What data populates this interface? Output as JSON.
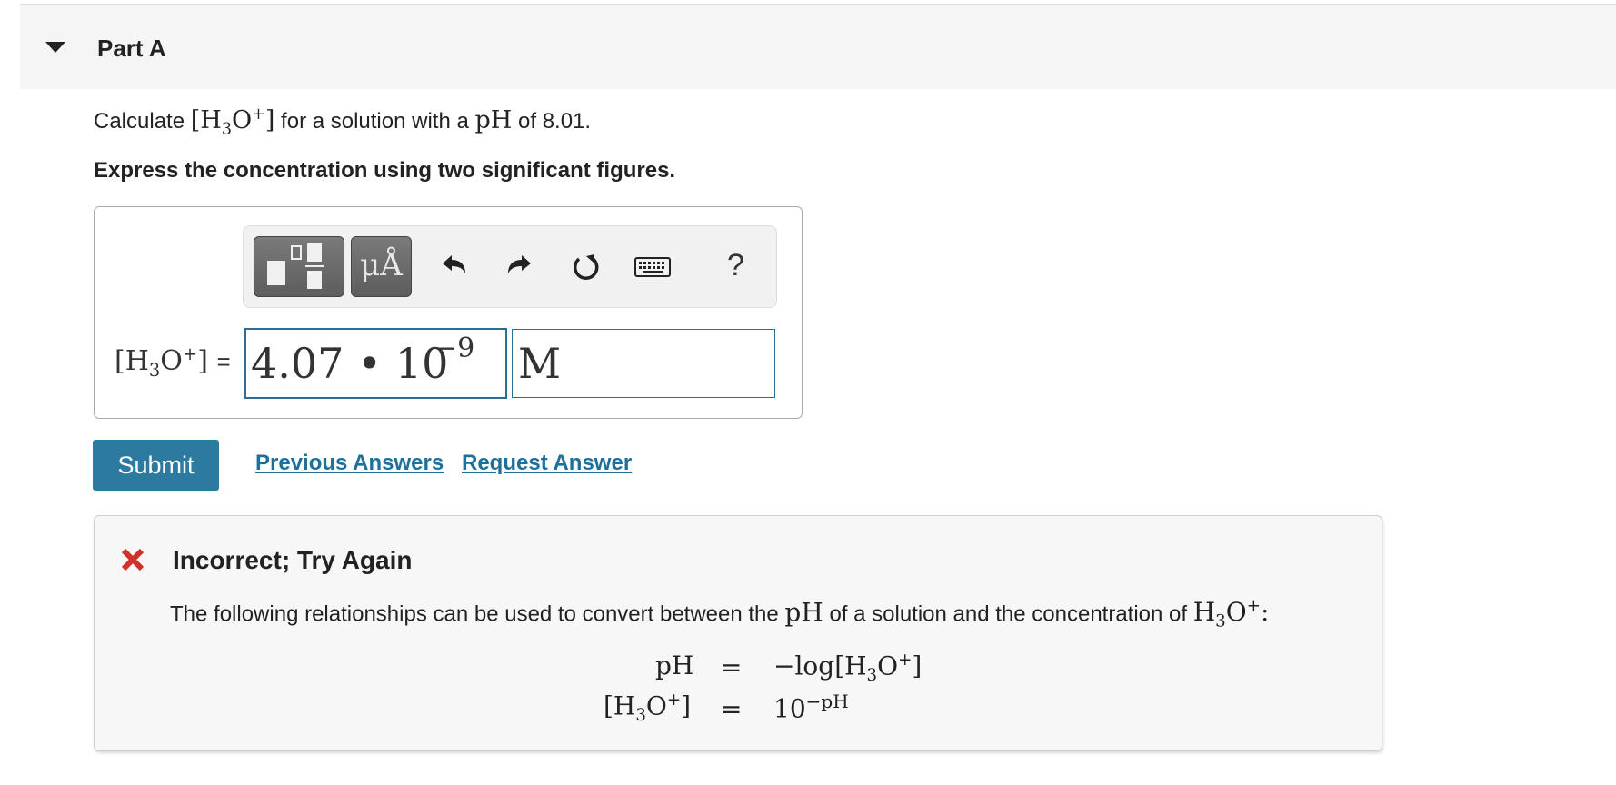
{
  "part": {
    "title": "Part A"
  },
  "question": {
    "prefix": "Calculate",
    "suffix": "for a solution with a",
    "ph_label": "pH",
    "ph_value_text": "of 8.01."
  },
  "instruction": "Express the concentration using two significant figures.",
  "toolbar": {
    "template_icon": "fraction-template-icon",
    "units_label": "μÅ",
    "undo_icon": "undo-icon",
    "redo_icon": "redo-icon",
    "reset_icon": "reset-icon",
    "keyboard_icon": "keyboard-icon",
    "help_label": "?"
  },
  "answer": {
    "label_equals": "=",
    "value_mantissa": "4.07",
    "value_dot": "•",
    "value_base": "10",
    "value_exponent": "−9",
    "unit": "M"
  },
  "actions": {
    "submit_label": "Submit",
    "previous_answers_label": "Previous Answers",
    "request_answer_label": "Request Answer"
  },
  "feedback": {
    "status_icon": "red-x-icon",
    "status_color": "#d0312d",
    "title": "Incorrect; Try Again",
    "text_prefix": "The following relationships can be used to convert between the",
    "text_middle": "of a solution and the concentration of",
    "ph": "pH",
    "eq1_rhs": "−log",
    "eq_equals": "=",
    "eq2_rhs_base": "10",
    "eq2_rhs_exp": "−pH"
  },
  "colors": {
    "accent": "#2d7aa0",
    "link": "#1f6f9a",
    "field_border": "#2a6f97"
  }
}
